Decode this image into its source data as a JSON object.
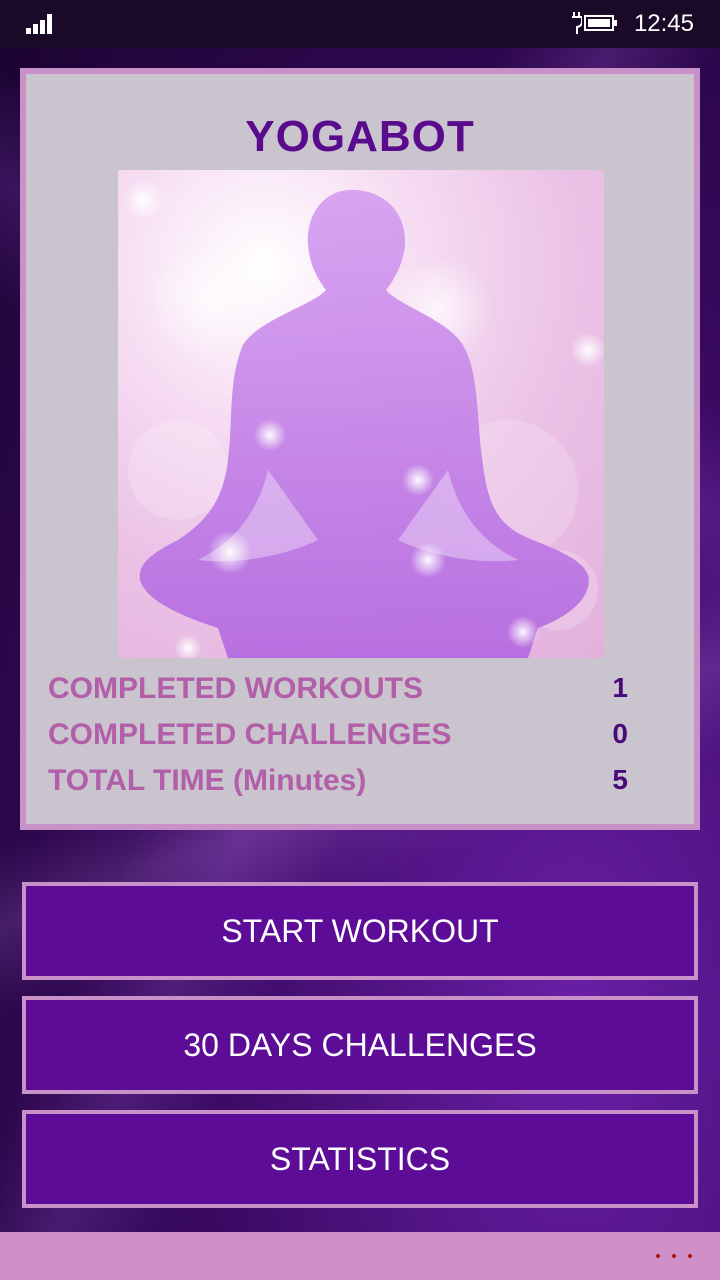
{
  "status_bar": {
    "time": "12:45"
  },
  "app": {
    "title": "YOGABOT"
  },
  "stats": [
    {
      "label": "COMPLETED WORKOUTS",
      "value": "1"
    },
    {
      "label": "COMPLETED CHALLENGES",
      "value": "0"
    },
    {
      "label": "TOTAL TIME (Minutes)",
      "value": "5"
    }
  ],
  "menu": {
    "start_workout": "START WORKOUT",
    "challenges": "30 DAYS CHALLENGES",
    "statistics": "STATISTICS"
  },
  "colors": {
    "title": "#5a0a8c",
    "stat_label": "#b25ea8",
    "stat_value": "#4a0a7a",
    "button_bg": "#5d0c98",
    "border": "#c891c8",
    "app_bar": "#cf8ec8"
  },
  "icons": {
    "signal": "signal-strength-icon",
    "battery": "battery-charging-icon",
    "more": "more-dots-icon"
  }
}
